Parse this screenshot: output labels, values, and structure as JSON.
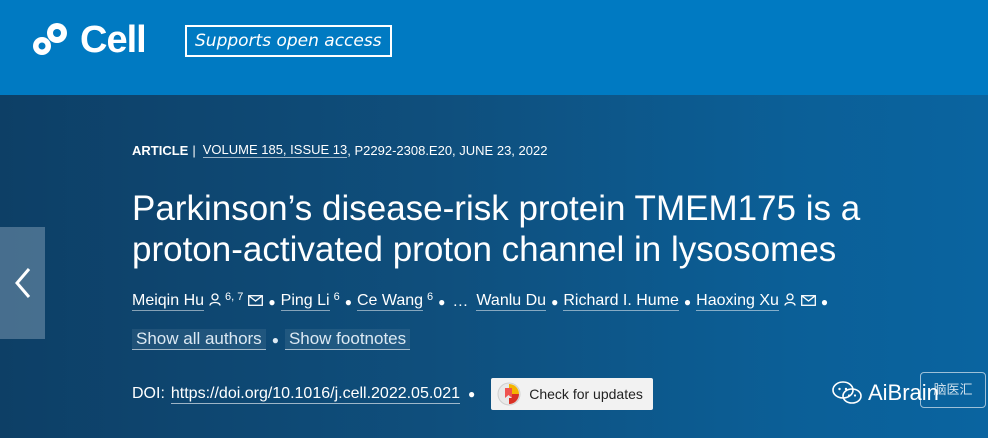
{
  "brand": {
    "logo_text": "Cell",
    "open_access_label": "Supports open access"
  },
  "nav": {
    "prev_icon": "chevron-left-icon"
  },
  "article_meta": {
    "type": "ARTICLE",
    "separator": "|",
    "volume_info": "VOLUME 185, ISSUE 13",
    "pages_date": ", P2292-2308.E20, JUNE 23, 2022"
  },
  "title": "Parkinson’s disease-risk protein TMEM175 is a proton-activated proton channel in lysosomes",
  "authors": [
    {
      "name": "Meiqin Hu",
      "sup": "6, 7",
      "icons": [
        "person-icon",
        "mail-icon"
      ]
    },
    {
      "name": "Ping Li",
      "sup": "6",
      "icons": []
    },
    {
      "name": "Ce Wang",
      "sup": "6",
      "icons": []
    },
    {
      "name": "…",
      "sup": "",
      "icons": []
    },
    {
      "name": "Wanlu Du",
      "sup": "",
      "icons": []
    },
    {
      "name": "Richard I. Hume",
      "sup": "",
      "icons": []
    },
    {
      "name": "Haoxing Xu",
      "sup": "",
      "icons": [
        "person-icon",
        "mail-icon"
      ]
    }
  ],
  "links": {
    "show_all_authors": "Show all authors",
    "show_footnotes": "Show footnotes"
  },
  "doi": {
    "label": "DOI:",
    "url": "https://doi.org/10.1016/j.cell.2022.05.021",
    "check_updates": "Check for updates"
  },
  "watermark": {
    "text": "AiBrain",
    "seal_text": "脑医汇"
  },
  "colors": {
    "topbar": "#007ac2",
    "hero_left": "#0d3f66",
    "hero_right": "#0a64a0"
  }
}
